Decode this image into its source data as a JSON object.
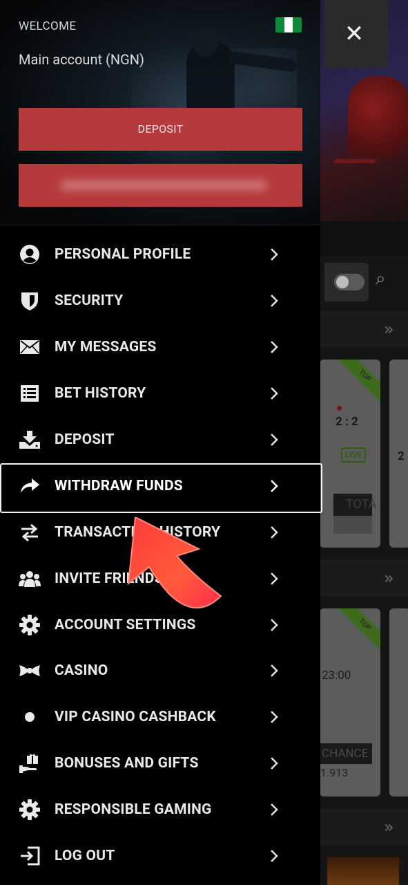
{
  "header": {
    "welcome": "WELCOME",
    "account": "Main account (NGN)",
    "deposit_button": "DEPOSIT",
    "flag_colors": [
      "#0b8a3a",
      "#ffffff",
      "#0b8a3a"
    ]
  },
  "menu": {
    "items": [
      {
        "label": "PERSONAL PROFILE",
        "icon": "user-icon"
      },
      {
        "label": "SECURITY",
        "icon": "shield-icon"
      },
      {
        "label": "MY MESSAGES",
        "icon": "envelope-icon"
      },
      {
        "label": "BET HISTORY",
        "icon": "list-icon"
      },
      {
        "label": "DEPOSIT",
        "icon": "download-tray-icon"
      },
      {
        "label": "WITHDRAW FUNDS",
        "icon": "share-arrow-icon"
      },
      {
        "label": "TRANSACTION HISTORY",
        "icon": "swap-arrows-icon"
      },
      {
        "label": "INVITE FRIENDS",
        "icon": "users-icon"
      },
      {
        "label": "ACCOUNT SETTINGS",
        "icon": "gear-icon"
      },
      {
        "label": "CASINO",
        "icon": "bowtie-icon"
      },
      {
        "label": "VIP CASINO CASHBACK",
        "icon": "dot-icon"
      },
      {
        "label": "BONUSES AND GIFTS",
        "icon": "gift-hand-icon"
      },
      {
        "label": "RESPONSIBLE GAMING",
        "icon": "gear-icon"
      },
      {
        "label": "LOG OUT",
        "icon": "logout-icon"
      }
    ]
  },
  "background": {
    "card1_score": "2 : 2",
    "card1_badge": "LIVE",
    "card1_button": "TOTA",
    "card2_time": "23:00",
    "card2_button": "CHANCE",
    "card2_odds": "1.913",
    "ribbon": "TOP",
    "side_digit": "2"
  },
  "colors": {
    "accent_red": "#b53a3b",
    "drawer_bg": "#000000",
    "text": "#e8e8e8"
  }
}
